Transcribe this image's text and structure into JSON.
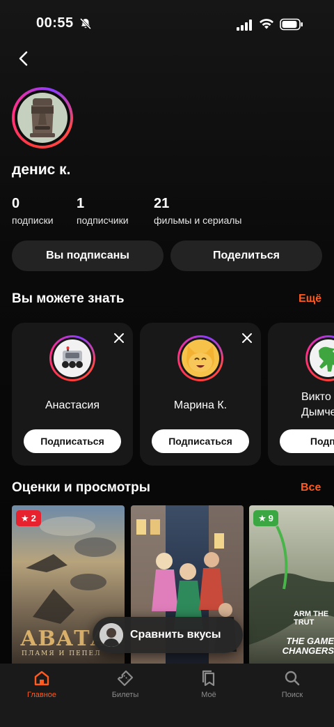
{
  "status_bar": {
    "time": "00:55"
  },
  "profile": {
    "name": "денис к.",
    "stats": [
      {
        "value": "0",
        "label": "подписки"
      },
      {
        "value": "1",
        "label": "подписчики"
      },
      {
        "value": "21",
        "label": "фильмы и сериалы"
      }
    ],
    "subscribed_label": "Вы подписаны",
    "share_label": "Поделиться"
  },
  "suggestions": {
    "title": "Вы можете знать",
    "more_label": "Ещё",
    "items": [
      {
        "name": "Анастасия",
        "follow_label": "Подписаться"
      },
      {
        "name": "Марина К.",
        "follow_label": "Подписаться"
      },
      {
        "name": "Викто Дымче",
        "follow_label": "Подпис"
      }
    ]
  },
  "ratings": {
    "title": "Оценки и просмотры",
    "all_label": "Все",
    "posters": [
      {
        "badge": "2",
        "badge_color": "#e8212e",
        "title_text": "АВАТАР",
        "subtitle_text": "ПЛАМЯ И ПЕПЕЛ"
      },
      {
        "badge": "",
        "badge_color": "",
        "title_text": "",
        "subtitle_text": ""
      },
      {
        "badge": "9",
        "badge_color": "#3aa742",
        "title_text": "THE GAME CHANGERS",
        "subtitle_text": "ARM THE TRUT"
      }
    ]
  },
  "compare_button": {
    "label": "Сравнить вкусы"
  },
  "bottom_nav": {
    "items": [
      {
        "label": "Главное",
        "icon": "home-icon",
        "active": true
      },
      {
        "label": "Билеты",
        "icon": "ticket-icon",
        "active": false
      },
      {
        "label": "Моё",
        "icon": "bookmarks-icon",
        "active": false
      },
      {
        "label": "Поиск",
        "icon": "search-icon",
        "active": false
      }
    ]
  },
  "colors": {
    "accent": "#ff5a1f",
    "background": "#000000",
    "card": "#181818",
    "button": "#232323"
  }
}
